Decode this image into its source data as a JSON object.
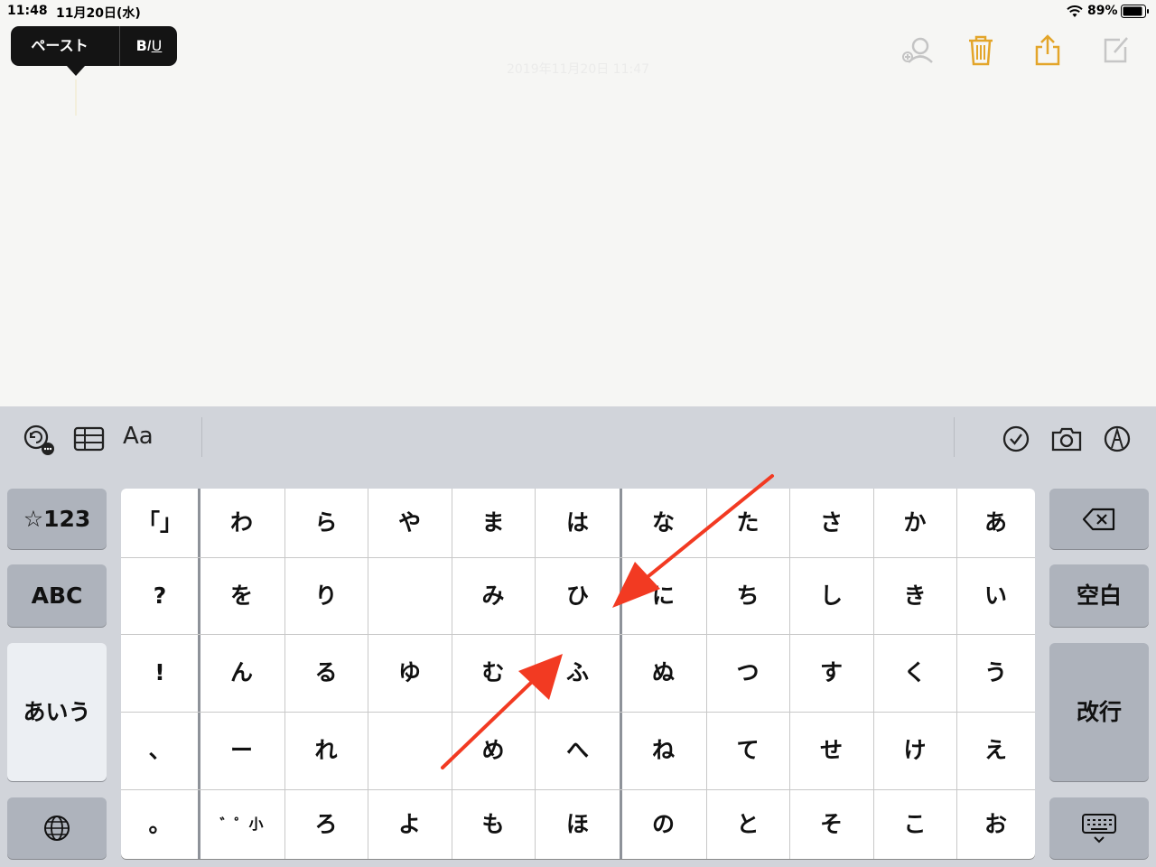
{
  "status_bar": {
    "time": "11:48",
    "date": "11月20日(水)",
    "battery_percent": "89%"
  },
  "edit_popup": {
    "paste_label": "ペースト",
    "format_label": "BIU"
  },
  "note": {
    "date_line": "2019年11月20日 11:47"
  },
  "toolbar_icons": [
    "add-person-icon",
    "trash-icon",
    "share-icon",
    "compose-icon"
  ],
  "format_bar": {
    "aa_label": "Aa",
    "icons": [
      "undo-icon",
      "table-icon",
      "checklist-icon",
      "camera-icon",
      "markup-icon"
    ]
  },
  "keyboard": {
    "left_keys": {
      "numbers": "☆123",
      "abc": "ABC",
      "kana": "あいう"
    },
    "right_keys": {
      "space": "空白",
      "return": "改行"
    },
    "rows": [
      [
        "「」",
        "わ",
        "ら",
        "や",
        "ま",
        "は",
        "な",
        "た",
        "さ",
        "か",
        "あ"
      ],
      [
        "?",
        "を",
        "り",
        "",
        "み",
        "ひ",
        "に",
        "ち",
        "し",
        "き",
        "い"
      ],
      [
        "!",
        "ん",
        "る",
        "ゆ",
        "む",
        "ふ",
        "ぬ",
        "つ",
        "す",
        "く",
        "う"
      ],
      [
        "、",
        "ー",
        "れ",
        "",
        "め",
        "へ",
        "ね",
        "て",
        "せ",
        "け",
        "え"
      ],
      [
        "。",
        "゛゜小",
        "ろ",
        "よ",
        "も",
        "ほ",
        "の",
        "と",
        "そ",
        "こ",
        "お"
      ]
    ]
  },
  "colors": {
    "accent_yellow": "#e3a52a",
    "arrow_red": "#f23a22",
    "keyboard_bg": "#d1d4da"
  }
}
